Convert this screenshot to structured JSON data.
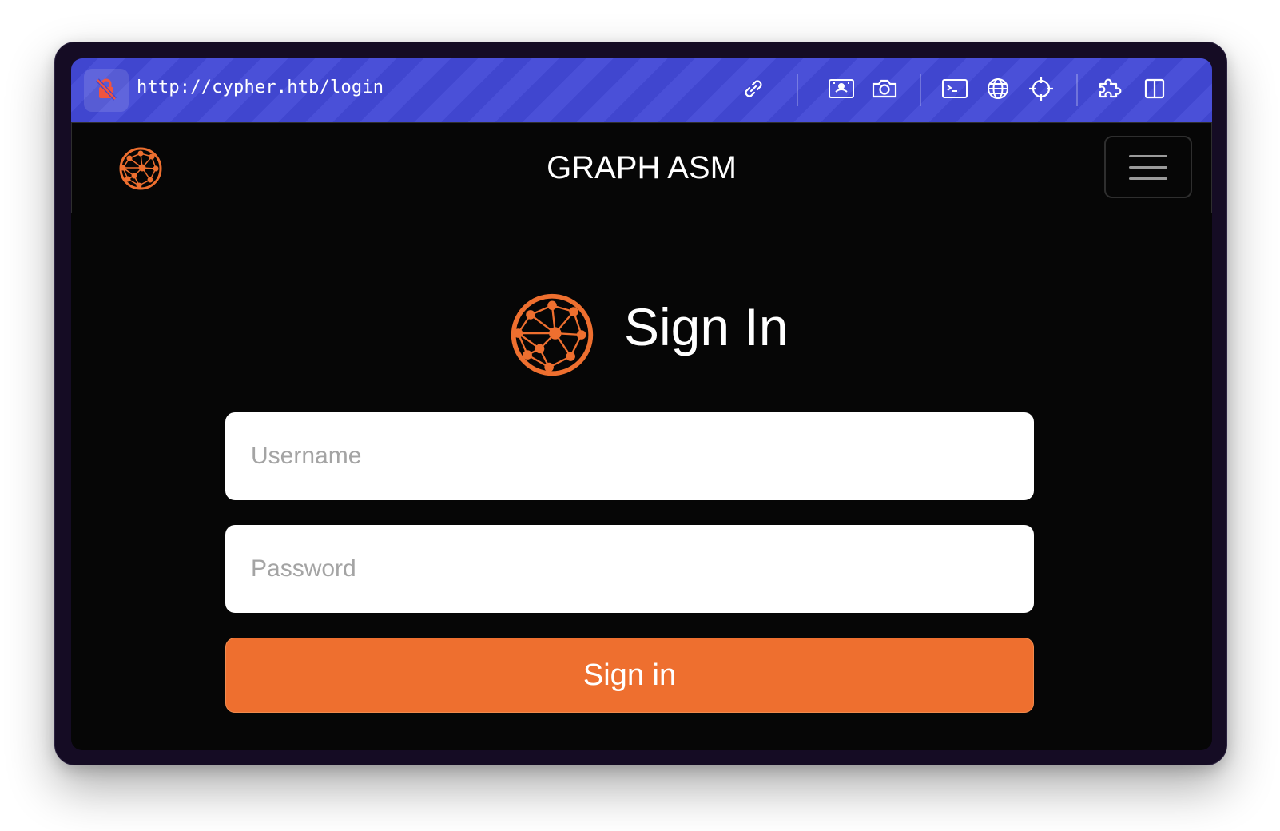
{
  "browser": {
    "url": "http://cypher.htb/login",
    "toolbar_icons": [
      "not-secure-lock-icon",
      "link-icon",
      "image-capture-icon",
      "camera-icon",
      "terminal-icon",
      "globe-icon",
      "crosshair-icon",
      "puzzle-icon",
      "sidebar-icon"
    ]
  },
  "navbar": {
    "brand": "GRAPH ASM",
    "logo_icon": "graph-network-icon",
    "menu_icon": "hamburger-icon"
  },
  "login": {
    "heading": "Sign In",
    "username_placeholder": "Username",
    "password_placeholder": "Password",
    "submit_label": "Sign in"
  },
  "colors": {
    "url_bar": "#4046cf",
    "accent": "#ee6f2f",
    "background": "#060606",
    "text": "#ffffff"
  }
}
